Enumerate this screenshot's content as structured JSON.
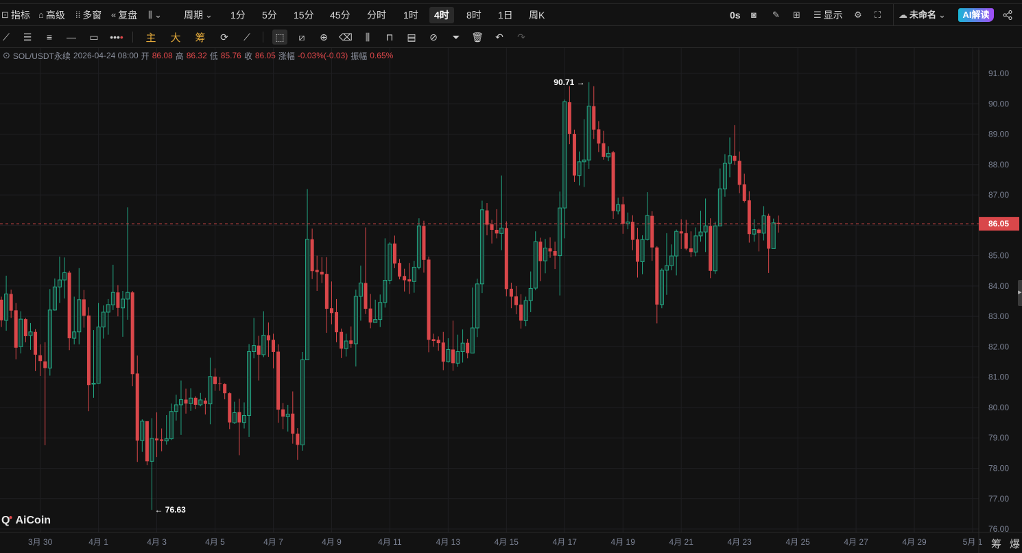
{
  "topbar": {
    "left": [
      {
        "icon": "indicator-icon",
        "label": "指标"
      },
      {
        "icon": "advanced-icon",
        "label": "高级"
      },
      {
        "icon": "multi-window-icon",
        "label": "多窗"
      },
      {
        "icon": "replay-icon",
        "label": "复盘"
      }
    ],
    "chart_type_icon": "candlestick-icon",
    "period_label": "周期",
    "intervals": [
      "1分",
      "5分",
      "15分",
      "45分",
      "分时",
      "1时",
      "4时",
      "8时",
      "1日",
      "周K"
    ],
    "active_interval": "4时",
    "countdown": "0s",
    "display_label": "显示",
    "layout_name": "未命名",
    "ai_label": "AI解读"
  },
  "toolbar": {
    "main_label": "主",
    "big_label": "大",
    "chip_label": "筹"
  },
  "info": {
    "symbol": "SOL/USDT永续",
    "datetime": "2026-04-24 08:00",
    "open_label": "开",
    "open": "86.08",
    "high_label": "高",
    "high": "86.32",
    "low_label": "低",
    "low": "85.76",
    "close_label": "收",
    "close": "86.05",
    "change_label": "涨幅",
    "change": "-0.03%(-0.03)",
    "amplitude_label": "振幅",
    "amplitude": "0.65%"
  },
  "logo": "AiCoin",
  "bottom_icons": [
    "筹",
    "爆"
  ],
  "colors": {
    "up": "#22a884",
    "down": "#d9474a",
    "bg": "#121212",
    "grid": "#1f1f22",
    "axis_text": "#7d8496"
  },
  "chart_data": {
    "type": "candlestick",
    "title": "SOL/USDT永续 4时",
    "interval": "4h",
    "first_candle": "2026-03-28 16:00",
    "last_candle": "2026-04-24 08:00",
    "ylim": [
      76,
      91
    ],
    "y_ticks": [
      "91.00",
      "90.00",
      "89.00",
      "88.00",
      "87.00",
      "86.00",
      "85.00",
      "84.00",
      "83.00",
      "82.00",
      "81.00",
      "80.00",
      "79.00",
      "78.00",
      "77.00",
      "76.00"
    ],
    "x_ticks": [
      "3月 30",
      "4月 1",
      "4月 3",
      "4月 5",
      "4月 7",
      "4月 9",
      "4月 11",
      "4月 13",
      "4月 15",
      "4月 17",
      "4月 19",
      "4月 21",
      "4月 23",
      "4月 25",
      "4月 27",
      "4月 29",
      "5月 1"
    ],
    "x_tick_first_index": 8,
    "x_tick_step": 12,
    "last_price": "86.05",
    "last_price_value": 86.05,
    "max_label": "90.71",
    "max_index": 121,
    "max_value": 90.71,
    "min_label": "76.63",
    "min_index": 31,
    "min_value": 76.63,
    "grid": true,
    "ohlc": [
      [
        83.55,
        83.65,
        82.65,
        82.87
      ],
      [
        82.87,
        84.34,
        82.53,
        83.74
      ],
      [
        83.74,
        83.88,
        82.95,
        83.19
      ],
      [
        83.2,
        83.44,
        81.59,
        81.97
      ],
      [
        82.0,
        83.17,
        81.78,
        82.91
      ],
      [
        82.91,
        82.95,
        82.15,
        82.35
      ],
      [
        82.37,
        82.78,
        81.9,
        82.49
      ],
      [
        82.49,
        82.58,
        81.2,
        81.74
      ],
      [
        81.72,
        82.08,
        81.04,
        81.53
      ],
      [
        81.52,
        82.15,
        78.76,
        81.3
      ],
      [
        81.3,
        83.9,
        81.05,
        83.21
      ],
      [
        83.21,
        84.25,
        83.19,
        83.97
      ],
      [
        83.97,
        84.97,
        83.44,
        84.2
      ],
      [
        84.2,
        84.94,
        83.59,
        84.44
      ],
      [
        84.44,
        84.5,
        81.89,
        82.28
      ],
      [
        82.28,
        83.65,
        82.08,
        82.49
      ],
      [
        82.49,
        84.59,
        82.08,
        83.55
      ],
      [
        83.56,
        83.87,
        82.63,
        83.02
      ],
      [
        83.03,
        83.3,
        79.88,
        80.74
      ],
      [
        80.77,
        82.55,
        80.32,
        80.8
      ],
      [
        80.8,
        83.44,
        80.8,
        82.65
      ],
      [
        82.65,
        83.36,
        82.27,
        83.14
      ],
      [
        83.14,
        83.57,
        82.4,
        83.39
      ],
      [
        83.38,
        84.7,
        83.21,
        83.79
      ],
      [
        83.79,
        84.03,
        83.0,
        83.28
      ],
      [
        83.28,
        83.84,
        82.33,
        83.57
      ],
      [
        83.57,
        86.59,
        82.89,
        83.79
      ],
      [
        83.79,
        83.84,
        80.7,
        81.1
      ],
      [
        81.12,
        81.71,
        78.21,
        78.91
      ],
      [
        78.91,
        79.61,
        78.54,
        79.55
      ],
      [
        79.55,
        79.55,
        78.1,
        78.23
      ],
      [
        78.23,
        79.65,
        76.63,
        78.98
      ],
      [
        78.98,
        79.84,
        78.37,
        78.92
      ],
      [
        78.95,
        79.31,
        78.56,
        78.9
      ],
      [
        78.9,
        79.75,
        78.78,
        78.97
      ],
      [
        78.97,
        80.13,
        78.93,
        79.87
      ],
      [
        79.87,
        80.42,
        79.57,
        80.09
      ],
      [
        80.09,
        80.89,
        79.1,
        80.26
      ],
      [
        80.26,
        80.62,
        79.8,
        80.13
      ],
      [
        80.13,
        80.63,
        79.89,
        80.31
      ],
      [
        80.32,
        80.37,
        79.95,
        80.09
      ],
      [
        80.09,
        80.48,
        80.04,
        80.25
      ],
      [
        80.23,
        80.32,
        79.77,
        80.12
      ],
      [
        80.12,
        81.64,
        79.45,
        81.02
      ],
      [
        81.02,
        81.29,
        80.55,
        80.77
      ],
      [
        80.79,
        81.0,
        80.55,
        80.77
      ],
      [
        80.77,
        80.8,
        80.27,
        80.47
      ],
      [
        80.47,
        80.5,
        79.29,
        79.51
      ],
      [
        79.5,
        80.19,
        79.46,
        79.83
      ],
      [
        79.85,
        80.29,
        78.43,
        79.51
      ],
      [
        79.51,
        80.17,
        79.31,
        79.74
      ],
      [
        79.74,
        82.09,
        79.03,
        81.84
      ],
      [
        81.84,
        82.95,
        81.62,
        82.04
      ],
      [
        82.04,
        82.36,
        80.89,
        81.74
      ],
      [
        81.74,
        83.17,
        81.66,
        82.38
      ],
      [
        82.38,
        82.8,
        81.67,
        82.21
      ],
      [
        82.23,
        82.43,
        81.29,
        81.83
      ],
      [
        81.84,
        82.08,
        79.5,
        79.93
      ],
      [
        79.94,
        80.15,
        79.29,
        79.7
      ],
      [
        79.7,
        80.09,
        79.21,
        79.78
      ],
      [
        79.8,
        80.53,
        78.81,
        79.14
      ],
      [
        79.14,
        79.32,
        78.28,
        78.77
      ],
      [
        78.77,
        81.83,
        78.58,
        81.57
      ],
      [
        81.57,
        87.19,
        81.57,
        85.54
      ],
      [
        85.54,
        85.89,
        84.23,
        84.49
      ],
      [
        84.53,
        85.0,
        83.84,
        84.46
      ],
      [
        84.47,
        84.95,
        84.1,
        84.38
      ],
      [
        84.4,
        84.95,
        82.46,
        83.25
      ],
      [
        83.27,
        84.15,
        82.74,
        83.11
      ],
      [
        83.14,
        83.57,
        82.15,
        82.48
      ],
      [
        82.49,
        82.6,
        81.63,
        81.94
      ],
      [
        81.94,
        82.43,
        81.68,
        82.19
      ],
      [
        82.21,
        82.67,
        81.97,
        82.1
      ],
      [
        82.1,
        83.88,
        81.35,
        83.66
      ],
      [
        83.66,
        84.67,
        82.86,
        84.1
      ],
      [
        84.1,
        85.93,
        83.08,
        83.25
      ],
      [
        83.26,
        83.74,
        82.61,
        82.8
      ],
      [
        82.8,
        83.55,
        82.8,
        82.9
      ],
      [
        82.9,
        83.72,
        82.65,
        83.46
      ],
      [
        83.46,
        85.57,
        83.29,
        84.19
      ],
      [
        84.19,
        85.44,
        84.06,
        85.38
      ],
      [
        85.4,
        85.66,
        84.59,
        84.74
      ],
      [
        84.76,
        84.89,
        84.22,
        84.31
      ],
      [
        84.33,
        84.57,
        83.82,
        84.19
      ],
      [
        84.22,
        84.76,
        83.74,
        84.15
      ],
      [
        84.15,
        84.83,
        83.78,
        84.62
      ],
      [
        84.62,
        86.23,
        84.55,
        85.98
      ],
      [
        85.98,
        86.15,
        84.44,
        84.86
      ],
      [
        84.87,
        84.97,
        81.82,
        82.23
      ],
      [
        82.25,
        82.43,
        82.0,
        82.19
      ],
      [
        82.23,
        82.34,
        81.87,
        82.12
      ],
      [
        82.14,
        82.49,
        81.23,
        81.51
      ],
      [
        81.51,
        82.28,
        81.48,
        81.91
      ],
      [
        81.91,
        82.86,
        81.21,
        81.46
      ],
      [
        81.46,
        82.4,
        81.34,
        81.84
      ],
      [
        81.84,
        82.57,
        81.48,
        82.12
      ],
      [
        82.13,
        82.26,
        81.62,
        81.79
      ],
      [
        81.79,
        83.95,
        81.79,
        82.62
      ],
      [
        82.62,
        84.24,
        82.32,
        84.07
      ],
      [
        84.07,
        86.81,
        83.77,
        86.51
      ],
      [
        86.49,
        86.73,
        85.67,
        86.02
      ],
      [
        86.03,
        86.18,
        85.4,
        85.85
      ],
      [
        85.85,
        86.53,
        85.57,
        85.73
      ],
      [
        85.73,
        87.64,
        85.18,
        85.91
      ],
      [
        85.91,
        86.13,
        83.66,
        83.9
      ],
      [
        83.91,
        84.11,
        83.27,
        83.65
      ],
      [
        83.66,
        84.0,
        83.07,
        83.37
      ],
      [
        83.39,
        83.73,
        82.6,
        82.86
      ],
      [
        82.86,
        83.65,
        82.68,
        83.52
      ],
      [
        83.52,
        84.48,
        83.14,
        83.92
      ],
      [
        83.93,
        85.8,
        83.86,
        85.46
      ],
      [
        85.46,
        85.59,
        84.16,
        84.82
      ],
      [
        84.83,
        85.55,
        84.42,
        85.25
      ],
      [
        85.24,
        85.6,
        84.93,
        85.14
      ],
      [
        85.15,
        85.46,
        84.56,
        85.0
      ],
      [
        85.0,
        87.11,
        83.69,
        86.57
      ],
      [
        86.57,
        90.14,
        85.57,
        90.07
      ],
      [
        90.05,
        90.58,
        88.67,
        89.01
      ],
      [
        89.01,
        89.15,
        87.43,
        87.64
      ],
      [
        87.64,
        88.43,
        87.31,
        88.09
      ],
      [
        88.09,
        89.49,
        87.26,
        88.15
      ],
      [
        88.15,
        90.71,
        87.86,
        89.92
      ],
      [
        89.92,
        90.58,
        88.84,
        89.15
      ],
      [
        89.16,
        89.43,
        88.41,
        88.69
      ],
      [
        88.7,
        89.11,
        88.16,
        88.25
      ],
      [
        88.25,
        88.6,
        88.11,
        88.37
      ],
      [
        88.4,
        88.45,
        86.21,
        86.47
      ],
      [
        86.47,
        86.91,
        86.36,
        86.68
      ],
      [
        86.69,
        86.94,
        85.72,
        86.05
      ],
      [
        86.05,
        86.42,
        85.87,
        86.11
      ],
      [
        86.11,
        86.33,
        85.18,
        85.52
      ],
      [
        85.54,
        85.92,
        84.28,
        84.8
      ],
      [
        84.8,
        85.67,
        84.39,
        85.53
      ],
      [
        85.53,
        87.09,
        85.5,
        86.32
      ],
      [
        86.31,
        86.46,
        84.83,
        85.27
      ],
      [
        85.27,
        85.31,
        82.77,
        83.39
      ],
      [
        83.39,
        84.58,
        83.27,
        84.52
      ],
      [
        84.52,
        85.74,
        83.71,
        84.67
      ],
      [
        84.67,
        85.37,
        84.52,
        84.99
      ],
      [
        84.99,
        85.86,
        84.35,
        85.8
      ],
      [
        85.8,
        86.2,
        85.22,
        85.73
      ],
      [
        85.74,
        86.18,
        85.18,
        85.23
      ],
      [
        85.24,
        85.8,
        84.95,
        85.12
      ],
      [
        85.12,
        85.93,
        84.98,
        85.65
      ],
      [
        85.65,
        86.48,
        85.46,
        85.78
      ],
      [
        85.78,
        86.88,
        85.12,
        85.98
      ],
      [
        85.98,
        86.23,
        84.26,
        84.5
      ],
      [
        84.5,
        86.12,
        84.4,
        85.98
      ],
      [
        85.98,
        87.87,
        85.98,
        87.2
      ],
      [
        87.2,
        88.34,
        86.94,
        88.04
      ],
      [
        88.04,
        88.89,
        87.58,
        88.29
      ],
      [
        88.29,
        89.3,
        87.99,
        88.12
      ],
      [
        88.12,
        88.43,
        87.06,
        87.33
      ],
      [
        87.35,
        87.7,
        86.75,
        86.8
      ],
      [
        86.82,
        87.12,
        85.43,
        85.71
      ],
      [
        85.71,
        86.2,
        85.46,
        85.86
      ],
      [
        85.86,
        85.9,
        85.14,
        85.74
      ],
      [
        85.74,
        86.63,
        85.5,
        86.31
      ],
      [
        86.31,
        86.38,
        84.43,
        85.23
      ],
      [
        85.23,
        86.22,
        85.23,
        86.08
      ],
      [
        86.08,
        86.32,
        85.76,
        86.05
      ]
    ]
  }
}
